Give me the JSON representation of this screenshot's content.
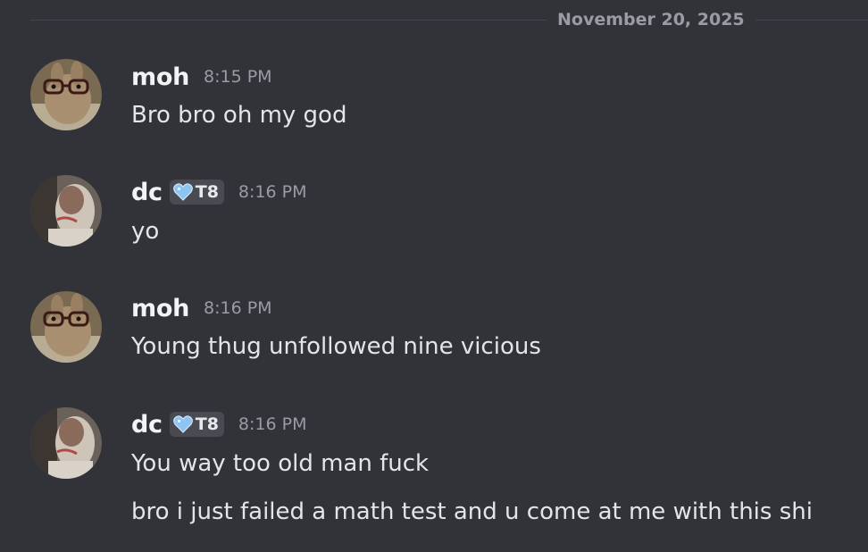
{
  "date_divider": "November 20, 2025",
  "messages": [
    {
      "author": "moh",
      "time": "8:15 PM",
      "lines": [
        "Bro bro oh my god"
      ]
    },
    {
      "author": "dc",
      "badge": "T8",
      "badge_icon": "heart-icon",
      "time": "8:16 PM",
      "lines": [
        "yo"
      ]
    },
    {
      "author": "moh",
      "time": "8:16 PM",
      "lines": [
        "Young thug unfollowed nine vicious"
      ]
    },
    {
      "author": "dc",
      "badge": "T8",
      "badge_icon": "heart-icon",
      "time": "8:16 PM",
      "lines": [
        "You way too old man fuck",
        "bro i just failed a math test and u come at me with this shi"
      ]
    }
  ],
  "colors": {
    "background": "#323339",
    "badge_heart": "#8fc3f2"
  }
}
